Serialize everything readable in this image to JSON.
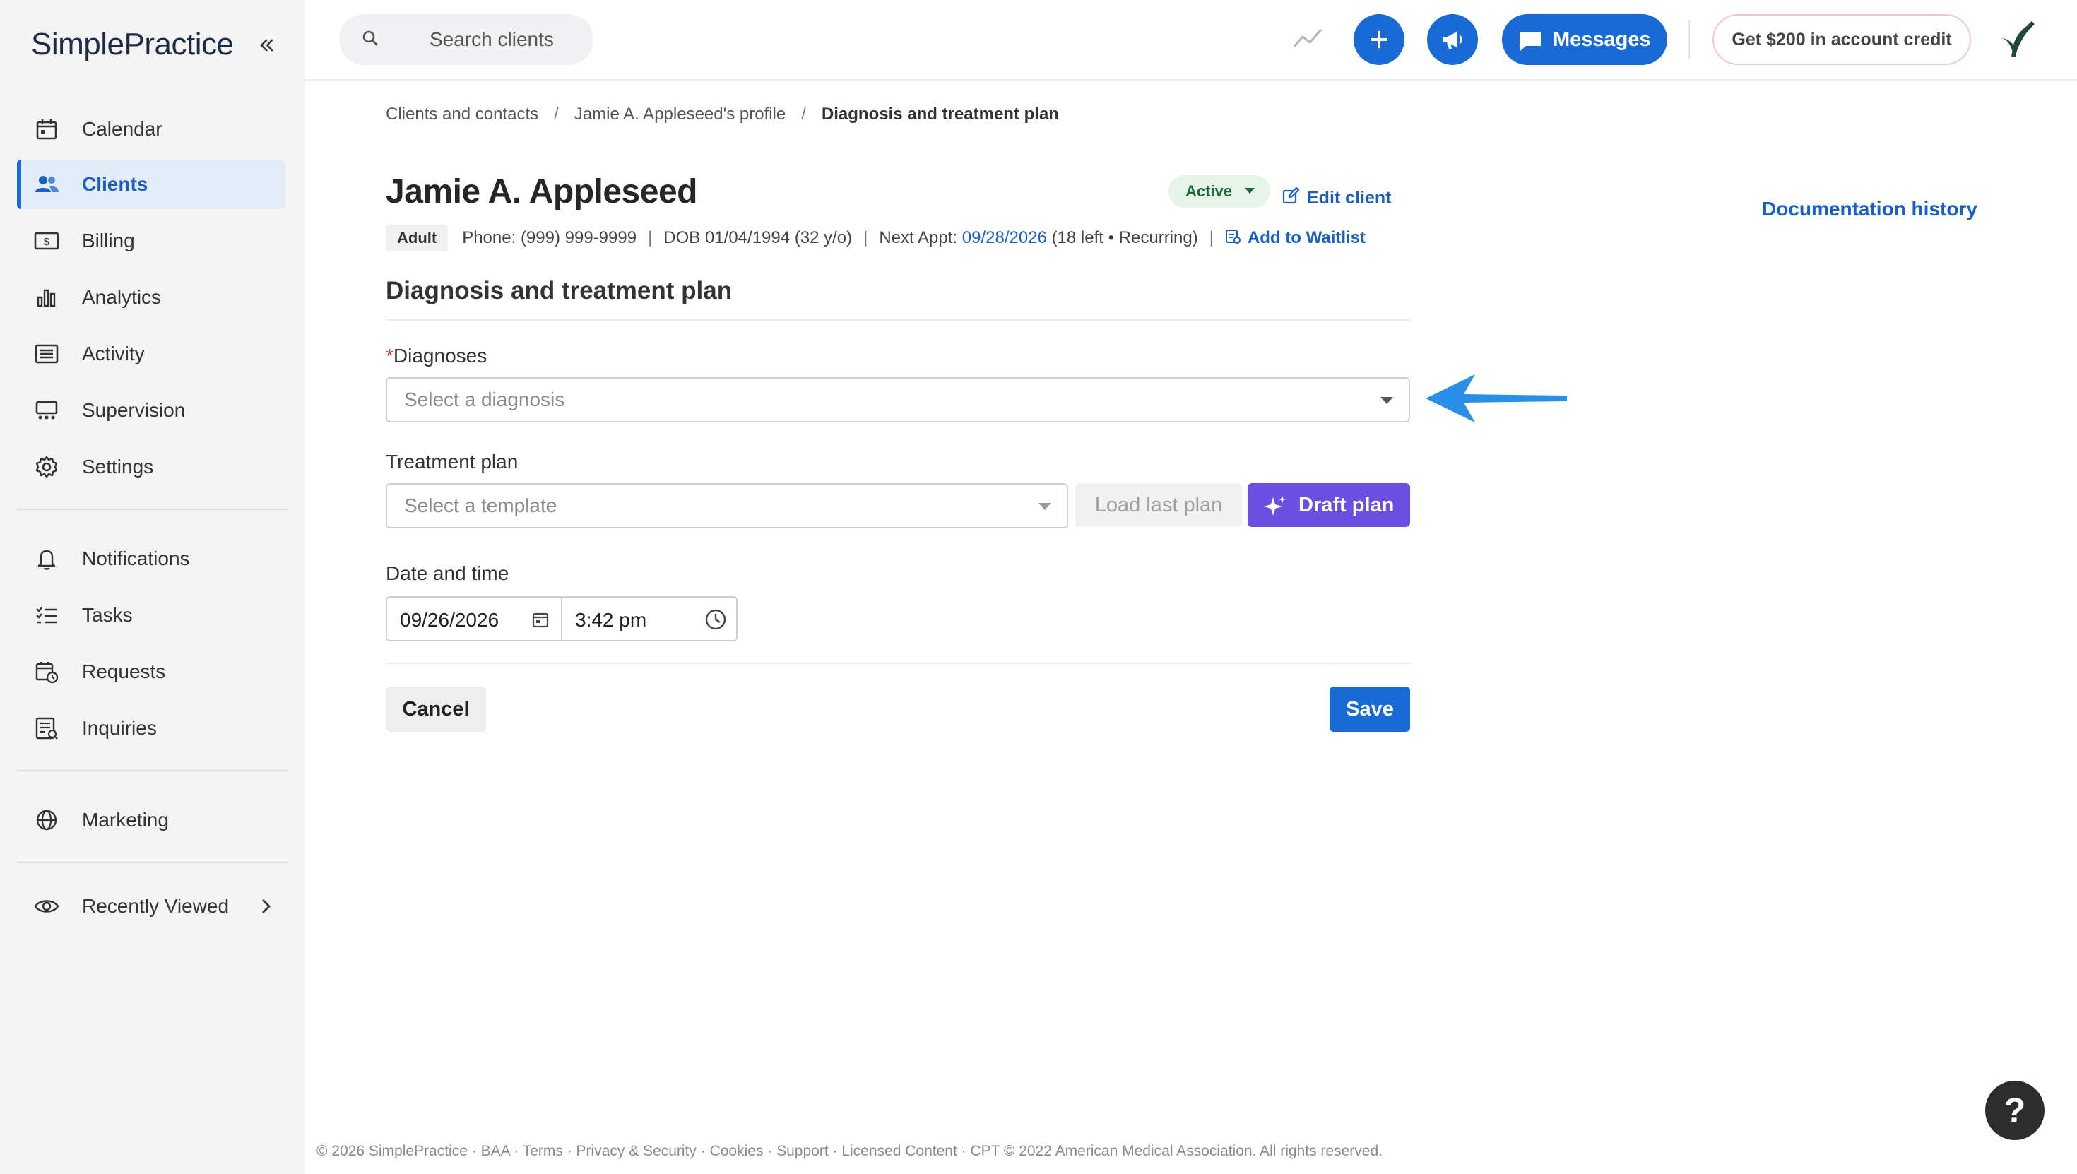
{
  "app": {
    "logo_text": "SimplePractice"
  },
  "sidebar": {
    "items": [
      {
        "label": "Calendar",
        "icon": "calendar-icon"
      },
      {
        "label": "Clients",
        "icon": "users-icon",
        "active": true
      },
      {
        "label": "Billing",
        "icon": "billing-icon"
      },
      {
        "label": "Analytics",
        "icon": "analytics-icon"
      },
      {
        "label": "Activity",
        "icon": "activity-icon"
      },
      {
        "label": "Supervision",
        "icon": "supervision-icon"
      },
      {
        "label": "Settings",
        "icon": "gear-icon"
      },
      {
        "label": "Notifications",
        "icon": "bell-icon"
      },
      {
        "label": "Tasks",
        "icon": "tasks-icon"
      },
      {
        "label": "Requests",
        "icon": "requests-icon"
      },
      {
        "label": "Inquiries",
        "icon": "inquiries-icon"
      },
      {
        "label": "Marketing",
        "icon": "globe-icon"
      },
      {
        "label": "Recently Viewed",
        "icon": "eye-icon"
      }
    ]
  },
  "topbar": {
    "search_placeholder": "Search clients",
    "messages_label": "Messages",
    "credit_label": "Get $200 in account credit"
  },
  "breadcrumb": {
    "items": [
      "Clients and contacts",
      "Jamie A. Appleseed's profile",
      "Diagnosis and treatment plan"
    ]
  },
  "client": {
    "name": "Jamie A. Appleseed",
    "status": "Active",
    "edit_label": "Edit client",
    "type_badge": "Adult",
    "phone": "Phone: (999) 999-9999",
    "dob": "DOB 01/04/1994 (32 y/o)",
    "next_appt_label": "Next Appt:",
    "next_appt_date": "09/28/2026",
    "next_appt_detail": "(18 left • Recurring)",
    "waitlist_label": "Add to Waitlist",
    "doc_history_label": "Documentation history"
  },
  "form": {
    "section_title": "Diagnosis and treatment plan",
    "diagnoses_required_mark": "*",
    "diagnoses_label": "Diagnoses",
    "diagnoses_placeholder": "Select a diagnosis",
    "treatment_label": "Treatment plan",
    "template_placeholder": "Select a template",
    "load_last_label": "Load last plan",
    "draft_label": "Draft plan",
    "datetime_label": "Date and time",
    "date_value": "09/26/2026",
    "time_value": "3:42 pm",
    "cancel_label": "Cancel",
    "save_label": "Save"
  },
  "footer": {
    "text": "© 2026 SimplePractice · BAA · Terms · Privacy & Security · Cookies · Support · Licensed Content · CPT © 2022 American Medical Association. All rights reserved."
  },
  "colors": {
    "primary": "#1a6ad6",
    "draft": "#6b4fe0",
    "active_bg": "#e6f4ea",
    "annotation_arrow": "#2b8fe8"
  }
}
